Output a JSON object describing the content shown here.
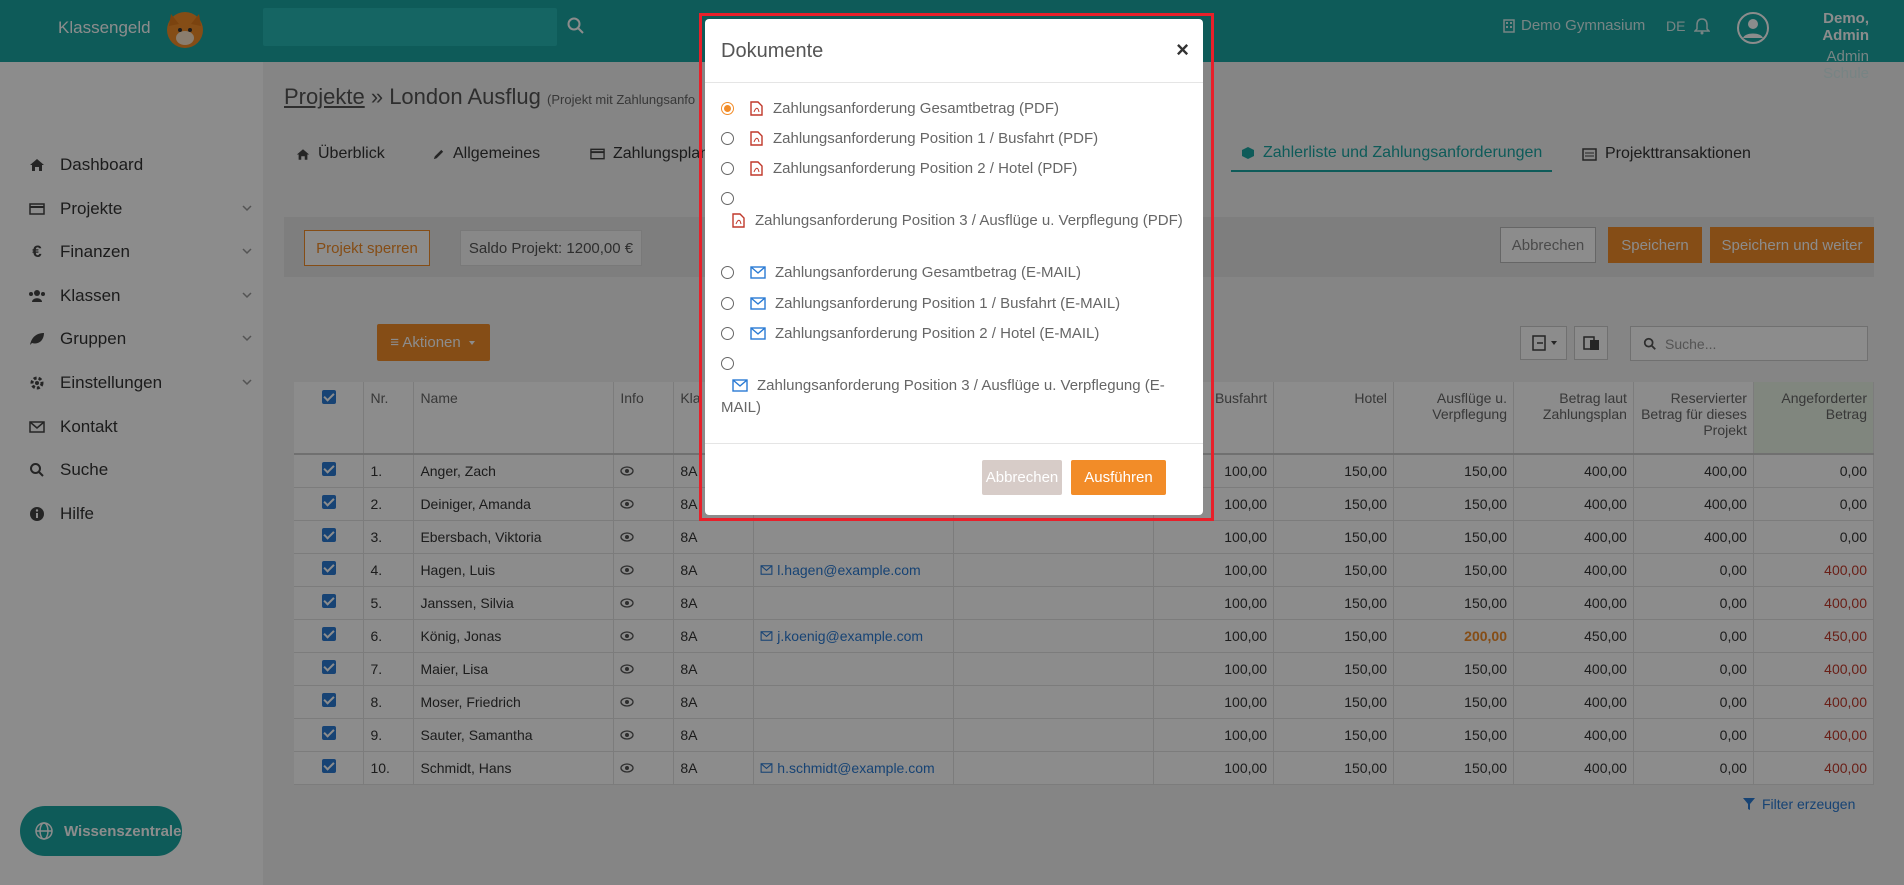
{
  "topbar": {
    "brand": "Klassengeld",
    "school": "Demo Gymnasium",
    "lang": "DE",
    "user_name": "Demo, Admin",
    "user_role": "Admin Schule"
  },
  "sidebar": {
    "items": [
      {
        "label": "Dashboard",
        "icon": "home-icon"
      },
      {
        "label": "Projekte",
        "icon": "card-icon"
      },
      {
        "label": "Finanzen",
        "icon": "euro-icon"
      },
      {
        "label": "Klassen",
        "icon": "users-icon"
      },
      {
        "label": "Gruppen",
        "icon": "leaf-icon"
      },
      {
        "label": "Einstellungen",
        "icon": "gear-icon"
      },
      {
        "label": "Kontakt",
        "icon": "mail-icon"
      },
      {
        "label": "Suche",
        "icon": "search-icon"
      },
      {
        "label": "Hilfe",
        "icon": "info-icon"
      }
    ],
    "wissen": "Wissenszentrale"
  },
  "breadcrumb": {
    "root": "Projekte",
    "sep": " » ",
    "current": "London Ausflug",
    "sub": "(Projekt mit Zahlungsanfo"
  },
  "tabs": [
    {
      "label": "Überblick"
    },
    {
      "label": "Allgemeines"
    },
    {
      "label": "Zahlungsplan"
    },
    {
      "label": "Zahlerliste und Zahlungsanforderungen"
    },
    {
      "label": "Projekttransaktionen"
    }
  ],
  "actionbar": {
    "lock": "Projekt sperren",
    "saldo": "Saldo Projekt: 1200,00 €",
    "cancel": "Abbrechen",
    "save": "Speichern",
    "save_next": "Speichern und weiter"
  },
  "toolbar": {
    "actions": "≡ Aktionen",
    "search_placeholder": "Suche..."
  },
  "table": {
    "headers": {
      "nr": "Nr.",
      "name": "Name",
      "info": "Info",
      "klasse": "Kla",
      "busfahrt": "Busfahrt",
      "hotel": "Hotel",
      "ausfluege": "Ausflüge u. Verpflegung",
      "betrag": "Betrag laut Zahlungsplan",
      "reserviert": "Reservierter Betrag für dieses Projekt",
      "angefordert": "Angeforderter Betrag"
    },
    "rows": [
      {
        "nr": "1.",
        "name": "Anger, Zach",
        "klasse": "8A",
        "email": "",
        "bus": "100,00",
        "hotel": "150,00",
        "ausfl": "150,00",
        "betrag": "400,00",
        "reserv": "400,00",
        "angef": "0,00"
      },
      {
        "nr": "2.",
        "name": "Deiniger, Amanda",
        "klasse": "8A",
        "email": "",
        "bus": "100,00",
        "hotel": "150,00",
        "ausfl": "150,00",
        "betrag": "400,00",
        "reserv": "400,00",
        "angef": "0,00"
      },
      {
        "nr": "3.",
        "name": "Ebersbach, Viktoria",
        "klasse": "8A",
        "email": "",
        "bus": "100,00",
        "hotel": "150,00",
        "ausfl": "150,00",
        "betrag": "400,00",
        "reserv": "400,00",
        "angef": "0,00"
      },
      {
        "nr": "4.",
        "name": "Hagen, Luis",
        "klasse": "8A",
        "email": "l.hagen@example.com",
        "bus": "100,00",
        "hotel": "150,00",
        "ausfl": "150,00",
        "betrag": "400,00",
        "reserv": "0,00",
        "angef": "400,00"
      },
      {
        "nr": "5.",
        "name": "Janssen, Silvia",
        "klasse": "8A",
        "email": "",
        "bus": "100,00",
        "hotel": "150,00",
        "ausfl": "150,00",
        "betrag": "400,00",
        "reserv": "0,00",
        "angef": "400,00"
      },
      {
        "nr": "6.",
        "name": "König, Jonas",
        "klasse": "8A",
        "email": "j.koenig@example.com",
        "bus": "100,00",
        "hotel": "150,00",
        "ausfl": "200,00",
        "betrag": "450,00",
        "reserv": "0,00",
        "angef": "450,00"
      },
      {
        "nr": "7.",
        "name": "Maier, Lisa",
        "klasse": "8A",
        "email": "",
        "bus": "100,00",
        "hotel": "150,00",
        "ausfl": "150,00",
        "betrag": "400,00",
        "reserv": "0,00",
        "angef": "400,00"
      },
      {
        "nr": "8.",
        "name": "Moser, Friedrich",
        "klasse": "8A",
        "email": "",
        "bus": "100,00",
        "hotel": "150,00",
        "ausfl": "150,00",
        "betrag": "400,00",
        "reserv": "0,00",
        "angef": "400,00"
      },
      {
        "nr": "9.",
        "name": "Sauter, Samantha",
        "klasse": "8A",
        "email": "",
        "bus": "100,00",
        "hotel": "150,00",
        "ausfl": "150,00",
        "betrag": "400,00",
        "reserv": "0,00",
        "angef": "400,00"
      },
      {
        "nr": "10.",
        "name": "Schmidt, Hans",
        "klasse": "8A",
        "email": "h.schmidt@example.com",
        "bus": "100,00",
        "hotel": "150,00",
        "ausfl": "150,00",
        "betrag": "400,00",
        "reserv": "0,00",
        "angef": "400,00"
      }
    ],
    "filter": "Filter erzeugen"
  },
  "modal": {
    "title": "Dokumente",
    "close": "×",
    "options": [
      {
        "label": "Zahlungsanforderung Gesamtbetrag (PDF)",
        "icon": "pdf-icon",
        "checked": true
      },
      {
        "label": "Zahlungsanforderung Position 1 / Busfahrt (PDF)",
        "icon": "pdf-icon"
      },
      {
        "label": "Zahlungsanforderung Position 2 / Hotel (PDF)",
        "icon": "pdf-icon"
      },
      {
        "label": "Zahlungsanforderung Position 3 / Ausflüge u. Verpflegung (PDF)",
        "icon": "pdf-icon"
      },
      {
        "label": "Zahlungsanforderung Gesamtbetrag (E-MAIL)",
        "icon": "envelope-icon"
      },
      {
        "label": "Zahlungsanforderung Position 1 / Busfahrt (E-MAIL)",
        "icon": "envelope-icon"
      },
      {
        "label": "Zahlungsanforderung Position 2 / Hotel (E-MAIL)",
        "icon": "envelope-icon"
      },
      {
        "label_line1": "Zahlungsanforderung Position 3 / Ausflüge u. Verpflegung (E-",
        "label_line2": "MAIL)",
        "icon": "envelope-icon"
      }
    ],
    "cancel": "Abbrechen",
    "run": "Ausführen"
  },
  "colors": {
    "brand": "#1ba7a3",
    "accent": "#f28c28",
    "highlight": "#e8202a",
    "pdf": "#c0392b",
    "mail": "#2a7bd4"
  }
}
